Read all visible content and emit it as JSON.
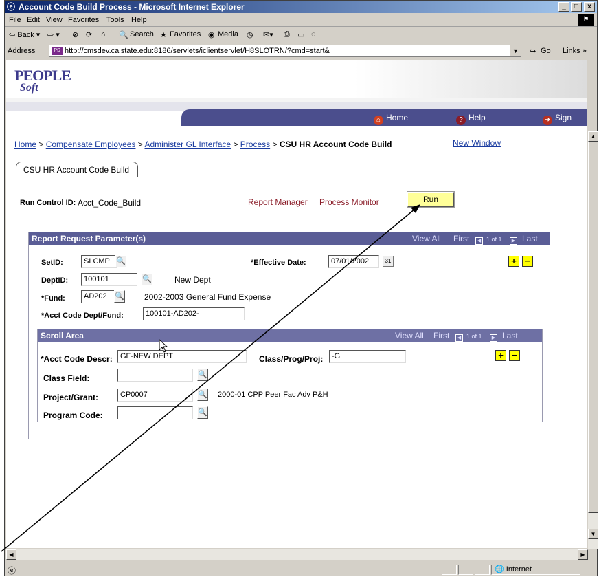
{
  "window": {
    "title": "Account Code Build Process - Microsoft Internet Explorer",
    "min_label": "_",
    "max_label": "□",
    "close_label": "x"
  },
  "menu": [
    "File",
    "Edit",
    "View",
    "Favorites",
    "Tools",
    "Help"
  ],
  "toolbar": {
    "back": "⇦ Back ▾",
    "forward": "⇨ ▾",
    "search": "Search",
    "favorites": "Favorites",
    "media": "Media"
  },
  "address": {
    "label": "Address",
    "url": "http://cmsdev.calstate.edu:8186/servlets/iclientservlet/H8SLOTRN/?cmd=start&",
    "go": "Go",
    "links": "Links »"
  },
  "peoplesoft": {
    "logo_top": "PEOPLE",
    "logo_bottom": "Soft",
    "nav_home": "Home",
    "nav_help": "Help",
    "nav_signout": "Sign Out"
  },
  "breadcrumb": {
    "home": "Home",
    "sep": ">",
    "compensate": "Compensate Employees",
    "administer": "Administer GL Interface",
    "process": "Process",
    "current": "CSU HR Account Code Build"
  },
  "new_window": "New Window",
  "tab_label": "CSU HR Account Code Build",
  "run_control": {
    "label": "Run Control ID:",
    "value": "Acct_Code_Build",
    "report_manager": "Report Manager",
    "process_monitor": "Process Monitor",
    "run": "Run"
  },
  "report_request": {
    "title": "Report Request Parameter(s)",
    "view_all": "View All",
    "first": "First",
    "counter": "1 of 1",
    "last": "Last",
    "setid_label": "SetID:",
    "setid_value": "SLCMP",
    "effdate_label": "*Effective Date:",
    "effdate_value": "07/01/2002",
    "deptid_label": "DeptID:",
    "deptid_value": "100101",
    "dept_desc": "New Dept",
    "fund_label": "*Fund:",
    "fund_value": "AD202",
    "fund_desc": "2002-2003 General Fund Expense",
    "acct_dept_fund_label": "*Acct Code Dept/Fund:",
    "acct_dept_fund_value": "100101-AD202-"
  },
  "scroll_area": {
    "title": "Scroll Area",
    "view_all": "View All",
    "first": "First",
    "counter": "1 of 1",
    "last": "Last",
    "acct_descr_label": "*Acct Code Descr:",
    "acct_descr_value": "GF-NEW DEPT",
    "class_prog_label": "Class/Prog/Proj:",
    "class_prog_value": "-G",
    "class_field_label": "Class Field:",
    "class_field_value": "",
    "project_label": "Project/Grant:",
    "project_value": "CP0007",
    "project_desc": "2000-01 CPP Peer Fac Adv P&H",
    "program_label": "Program Code:",
    "program_value": ""
  },
  "status": {
    "zone": "Internet"
  },
  "colors": {
    "nav_bar": "#4b4e8d",
    "group_header": "#5a5d96",
    "run_button": "#ffff99",
    "process_link": "#8a1c28",
    "link": "#1a3ca0"
  }
}
